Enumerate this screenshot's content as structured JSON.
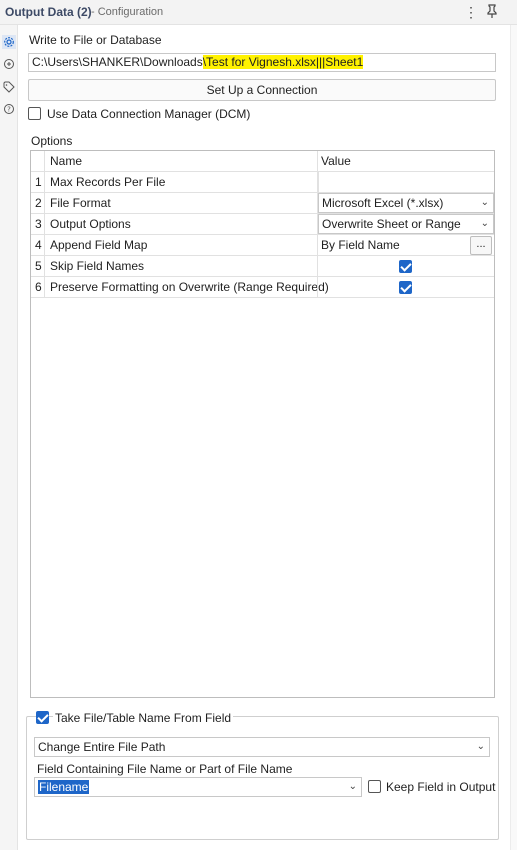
{
  "header": {
    "title": "Output Data (2)",
    "subtitle": "- Configuration",
    "menu_icon": "vertical-ellipsis-icon",
    "pin_icon": "pin-icon"
  },
  "rail": {
    "icons": [
      "gear-icon",
      "tool-icon",
      "tag-icon",
      "help-icon"
    ]
  },
  "write_to": {
    "label": "Write to File or Database",
    "path_prefix": "C:\\Users\\SHANKER\\Downloads",
    "path_highlight": "\\Test for Vignesh.xlsx|||Sheet1",
    "setup_button": "Set Up a Connection"
  },
  "dcm": {
    "label": "Use Data Connection Manager (DCM)",
    "checked": false
  },
  "options": {
    "label": "Options",
    "headers": {
      "name": "Name",
      "value": "Value"
    },
    "rows": [
      {
        "num": "1",
        "name": "Max Records Per File",
        "value": ""
      },
      {
        "num": "2",
        "name": "File Format",
        "value": "Microsoft Excel (*.xlsx)"
      },
      {
        "num": "3",
        "name": "Output Options",
        "value": "Overwrite Sheet or Range"
      },
      {
        "num": "4",
        "name": "Append Field Map",
        "value": "By Field Name",
        "button": "..."
      },
      {
        "num": "5",
        "name": "Skip Field Names",
        "checked": true
      },
      {
        "num": "6",
        "name": "Preserve Formatting on Overwrite (Range Required)",
        "checked": true
      }
    ]
  },
  "take_name": {
    "label": "Take File/Table Name From Field",
    "checked": true,
    "mode": "Change Entire File Path",
    "field_label": "Field Containing File Name or Part of File Name",
    "field_value": "Filename",
    "keep_label": "Keep Field in Output",
    "keep_checked": false
  },
  "colors": {
    "accent": "#1e66c8",
    "highlight": "#fff200",
    "title": "#3d4a66"
  }
}
